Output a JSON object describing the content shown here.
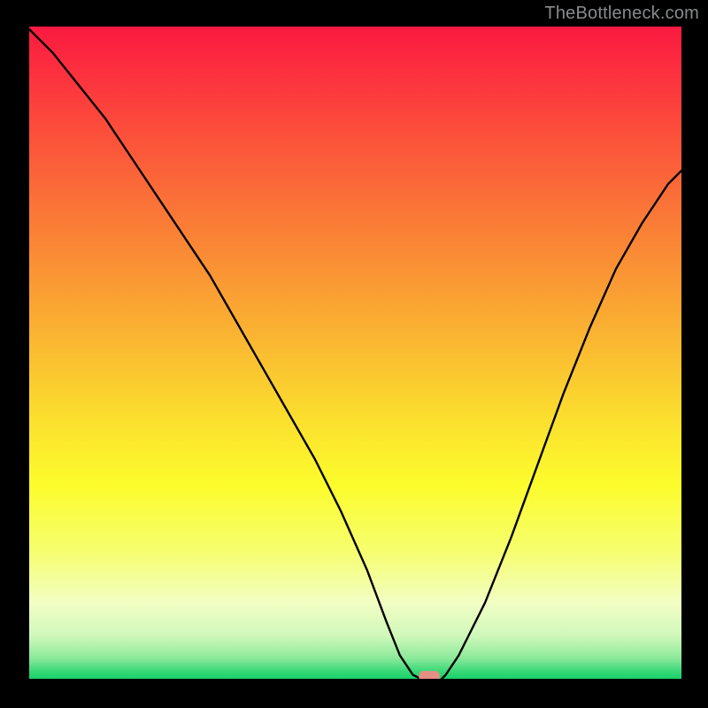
{
  "watermark": "TheBottleneck.com",
  "chart_data": {
    "type": "line",
    "title": "",
    "xlabel": "",
    "ylabel": "",
    "xlim": [
      0,
      100
    ],
    "ylim": [
      0,
      100
    ],
    "x": [
      0,
      4,
      8,
      12,
      16,
      20,
      24,
      28,
      32,
      36,
      40,
      44,
      48,
      52,
      55,
      57,
      59,
      61,
      63,
      64,
      66,
      70,
      74,
      78,
      82,
      86,
      90,
      94,
      98,
      100
    ],
    "values": [
      100,
      96,
      91,
      86,
      80,
      74,
      68,
      62,
      55,
      48,
      41,
      34,
      26,
      17,
      9,
      4,
      1,
      0,
      0,
      1,
      4,
      12,
      22,
      33,
      44,
      54,
      63,
      70,
      76,
      78
    ],
    "marker": {
      "x": 61.5,
      "y": 0,
      "width_pct": 3.2,
      "height_pct": 1.6,
      "color": "#e58f84"
    },
    "gradient_stops": [
      {
        "offset": 0.0,
        "color": "#fb1a41"
      },
      {
        "offset": 0.1,
        "color": "#fc3a3d"
      },
      {
        "offset": 0.22,
        "color": "#fb6239"
      },
      {
        "offset": 0.35,
        "color": "#fa8c35"
      },
      {
        "offset": 0.48,
        "color": "#fab731"
      },
      {
        "offset": 0.6,
        "color": "#fbdf2e"
      },
      {
        "offset": 0.7,
        "color": "#fcfc2c"
      },
      {
        "offset": 0.8,
        "color": "#f6fe6e"
      },
      {
        "offset": 0.88,
        "color": "#f2fec4"
      },
      {
        "offset": 0.93,
        "color": "#d0f8bb"
      },
      {
        "offset": 0.965,
        "color": "#8ae999"
      },
      {
        "offset": 0.985,
        "color": "#37d876"
      },
      {
        "offset": 1.0,
        "color": "#0cd065"
      }
    ]
  }
}
